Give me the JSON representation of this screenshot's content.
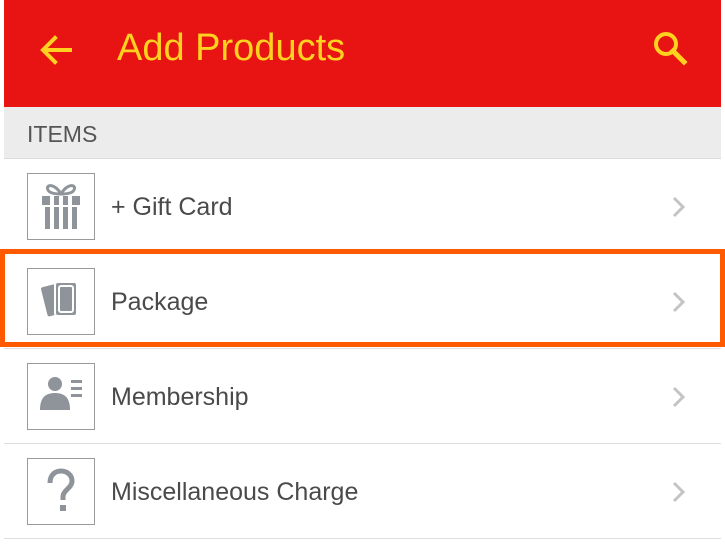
{
  "app_bar": {
    "title": "Add Products",
    "back_icon": "arrow-left-icon",
    "search_icon": "search-icon",
    "background_color": "#e81414",
    "foreground_color": "#ffd21f"
  },
  "section": {
    "label": "ITEMS"
  },
  "items": [
    {
      "label": "+ Gift Card",
      "icon": "gift-icon"
    },
    {
      "label": "Package",
      "icon": "package-cards-icon"
    },
    {
      "label": "Membership",
      "icon": "membership-card-icon"
    },
    {
      "label": "Miscellaneous Charge",
      "icon": "question-mark-icon"
    }
  ],
  "highlight": {
    "item_label": "Package",
    "color": "#ff5a00"
  }
}
